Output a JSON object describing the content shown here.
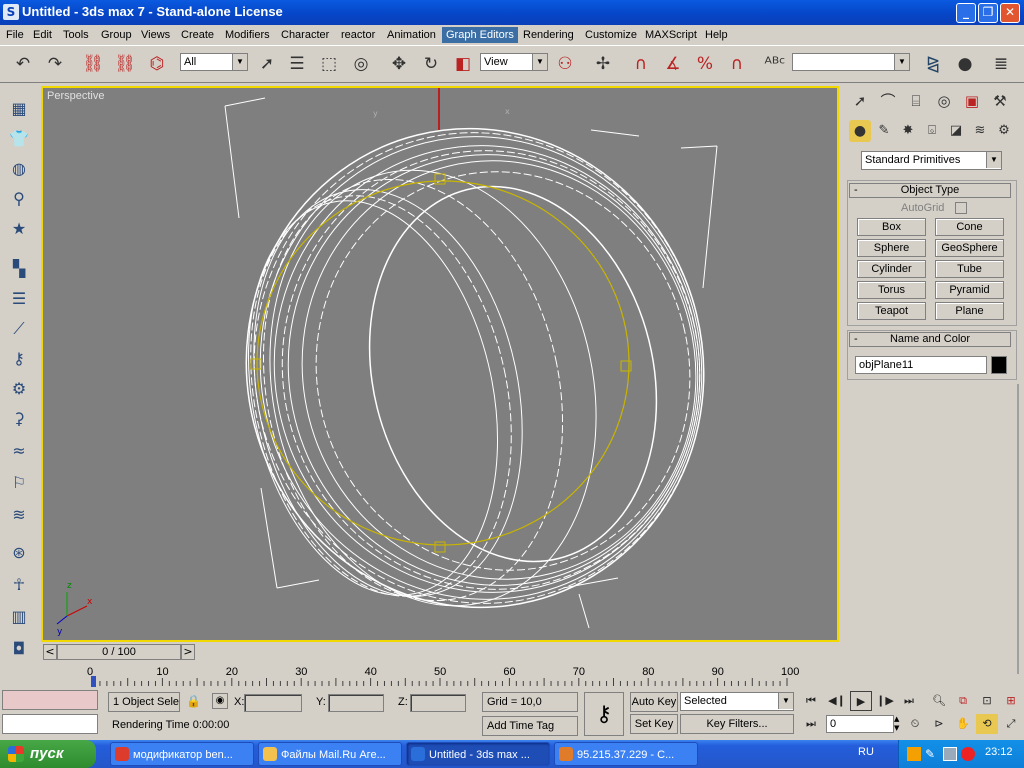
{
  "window": {
    "title": "Untitled - 3ds max 7  - Stand-alone License",
    "app_icon": "S",
    "min": "_",
    "max": "❐",
    "close": "✕"
  },
  "menu": [
    "File",
    "Edit",
    "Tools",
    "Group",
    "Views",
    "Create",
    "Modifiers",
    "Character",
    "reactor",
    "Animation",
    "Graph Editors",
    "Rendering",
    "Customize",
    "MAXScript",
    "Help"
  ],
  "menu_active_index": 10,
  "toolbar": {
    "selection_filter": "All",
    "ref_coord": "View",
    "named_selection": ""
  },
  "viewport": {
    "label": "Perspective",
    "axis_x": "x",
    "axis_y": "y",
    "axis_z": "z",
    "gizmo_x": "x",
    "gizmo_y": "y",
    "gizmo_z": "z"
  },
  "command_panel": {
    "category": "Standard Primitives",
    "object_type": {
      "header": "Object Type",
      "autogrid": "AutoGrid",
      "buttons": [
        "Box",
        "Cone",
        "Sphere",
        "GeoSphere",
        "Cylinder",
        "Tube",
        "Torus",
        "Pyramid",
        "Teapot",
        "Plane"
      ]
    },
    "name_color": {
      "header": "Name and Color",
      "name": "objPlane11",
      "color": "#000000"
    },
    "minus": "-"
  },
  "time_slider": {
    "label": "0 / 100",
    "prev": "<",
    "next": ">"
  },
  "trackbar": {
    "ticks": [
      "0",
      "10",
      "20",
      "30",
      "40",
      "50",
      "60",
      "70",
      "80",
      "90",
      "100"
    ]
  },
  "status": {
    "selection": "1 Object Sele",
    "x_label": "X:",
    "y_label": "Y:",
    "z_label": "Z:",
    "x": "",
    "y": "",
    "z": "",
    "grid": "Grid = 10,0",
    "rendering_time": "Rendering Time  0:00:00",
    "add_time_tag": "Add Time Tag",
    "auto_key": "Auto Key",
    "set_key": "Set Key",
    "key_mode": "Selected",
    "key_filters": "Key Filters...",
    "frame": "0"
  },
  "taskbar": {
    "start": "пуск",
    "tasks": [
      {
        "label": "модификатор ben...",
        "color": "#dd3b2b"
      },
      {
        "label": "Файлы Mail.Ru Аге...",
        "color": "#f2c14e"
      },
      {
        "label": "Untitled - 3ds max ...",
        "color": "#2a6fd9"
      },
      {
        "label": "95.215.37.229 - C...",
        "color": "#e07b2a"
      }
    ],
    "lang": "RU",
    "clock": "23:12"
  }
}
